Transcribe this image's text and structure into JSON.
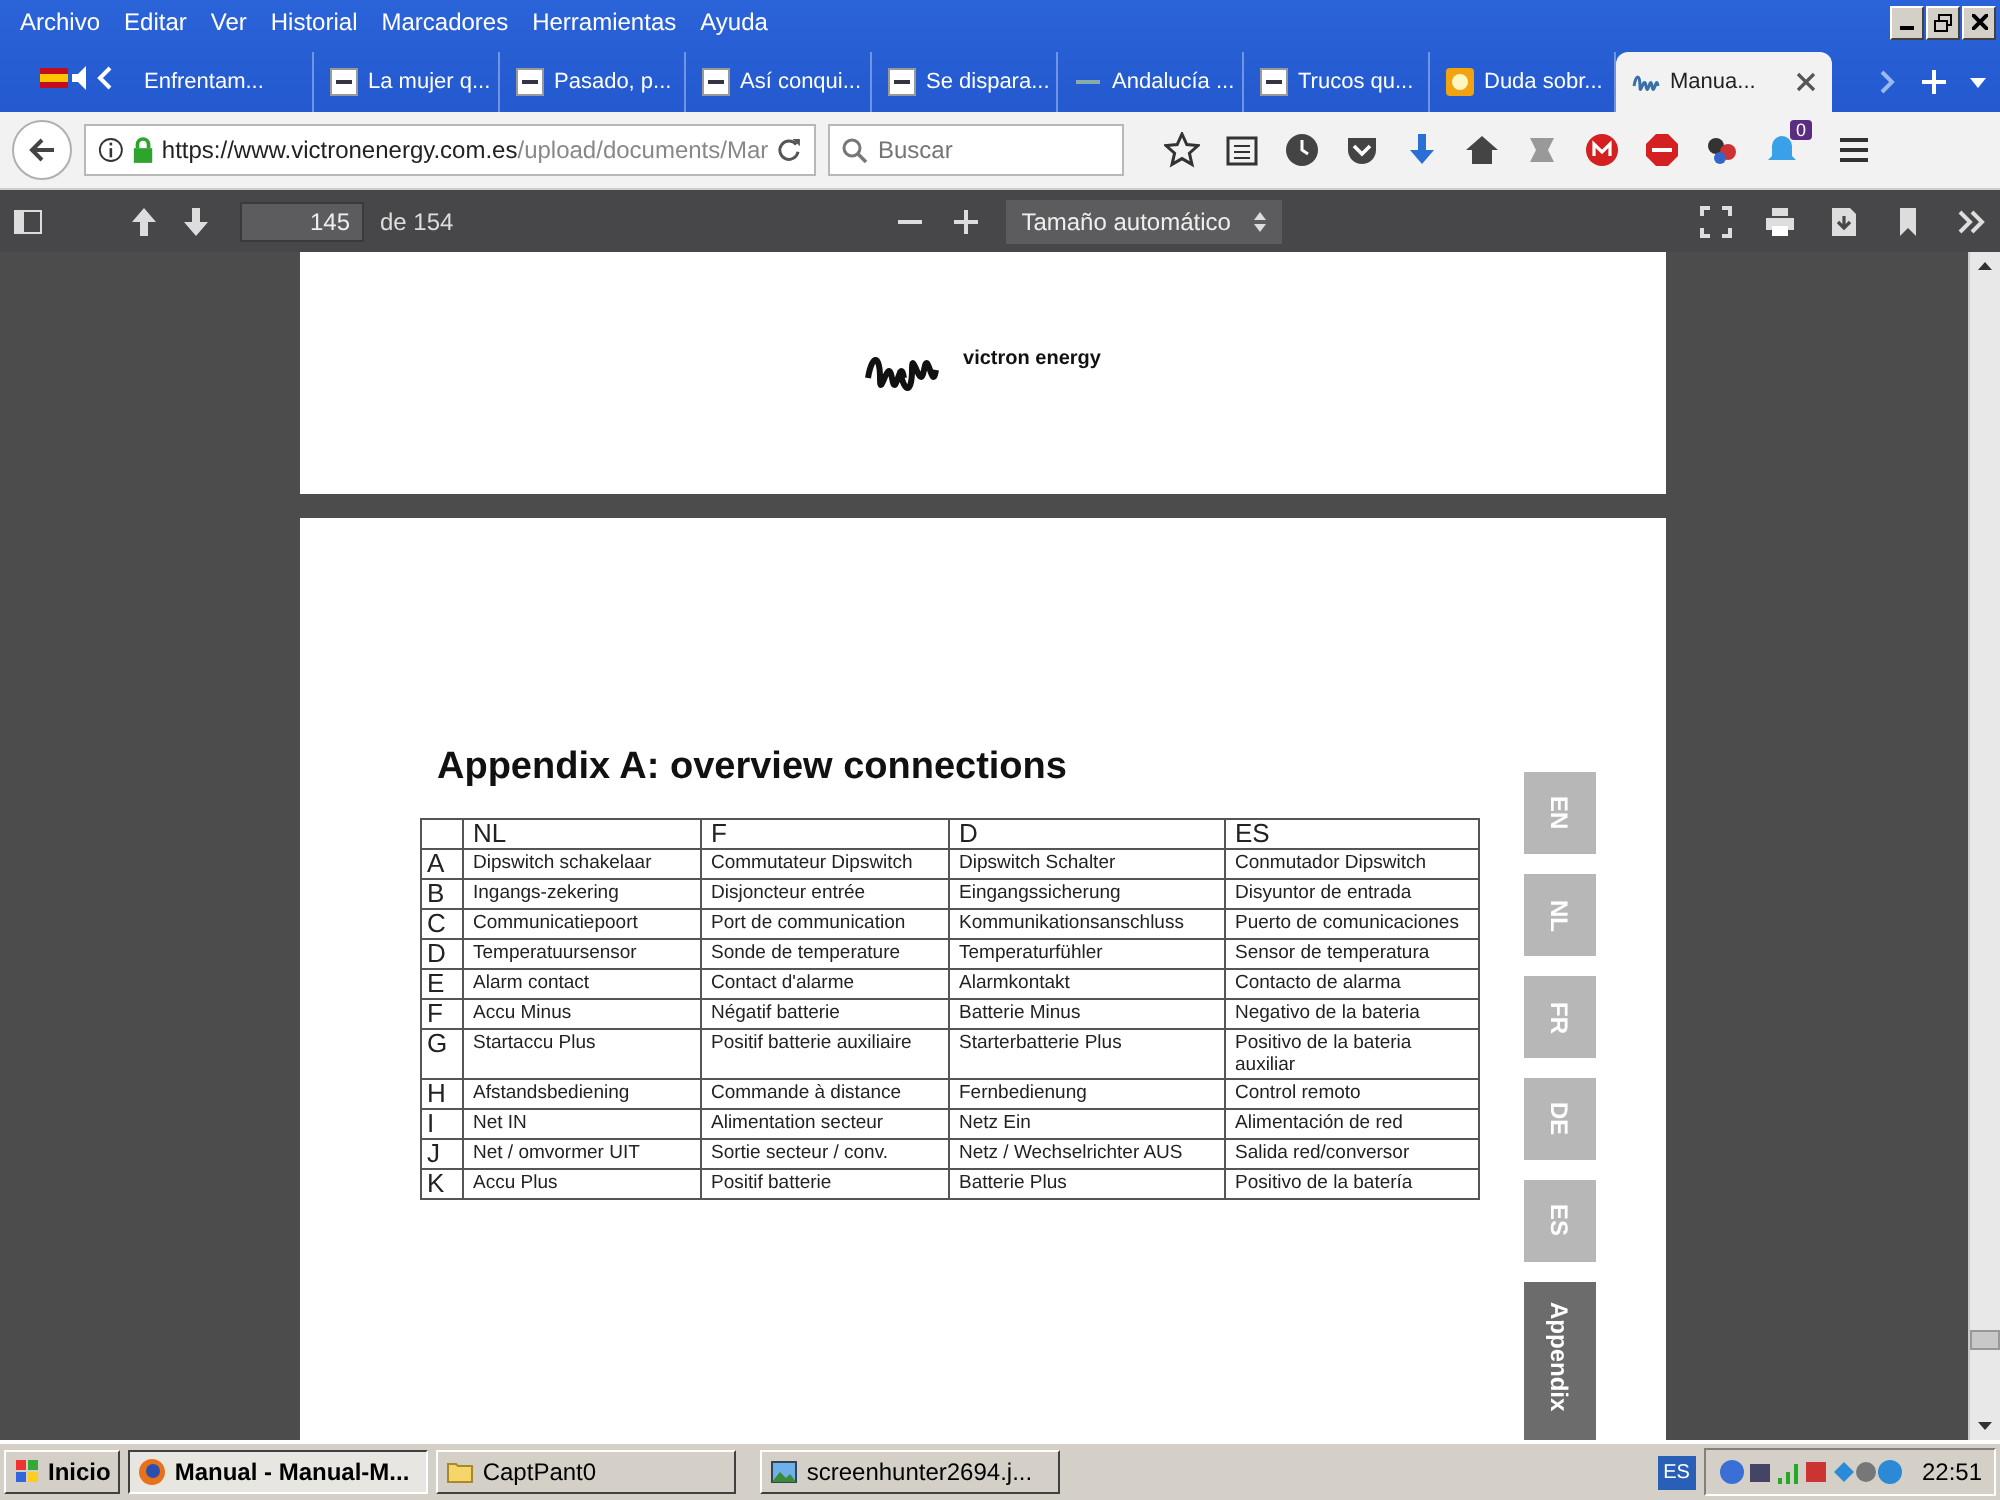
{
  "menu": [
    "Archivo",
    "Editar",
    "Ver",
    "Historial",
    "Marcadores",
    "Herramientas",
    "Ayuda"
  ],
  "tabs": [
    {
      "label": "Enfrentam...",
      "kind": "none",
      "selected": false
    },
    {
      "label": "La mujer q...",
      "kind": "abc",
      "selected": false
    },
    {
      "label": "Pasado, p...",
      "kind": "abc",
      "selected": false
    },
    {
      "label": "Así conqui...",
      "kind": "abc",
      "selected": false
    },
    {
      "label": "Se dispara...",
      "kind": "abc",
      "selected": false
    },
    {
      "label": "Andalucía ...",
      "kind": "abc-faded",
      "selected": false
    },
    {
      "label": "Trucos qu...",
      "kind": "abc",
      "selected": false
    },
    {
      "label": "Duda sobr...",
      "kind": "bulb",
      "selected": false
    },
    {
      "label": "Manua...",
      "kind": "coil",
      "selected": true
    }
  ],
  "address": {
    "host": "https://www.victronenergy.com.es",
    "path": "/upload/documents/Mar"
  },
  "search": {
    "placeholder": "Buscar"
  },
  "notification_badge": "0",
  "pdf_toolbar": {
    "page": "145",
    "page_count": "de 154",
    "zoom": "Tamaño automático"
  },
  "page_header": {
    "brand": "victron energy"
  },
  "document": {
    "title": "Appendix A: overview connections",
    "columns": [
      "NL",
      "F",
      "D",
      "ES"
    ],
    "rows": [
      {
        "key": "A",
        "cells": [
          "Dipswitch schakelaar",
          "Commutateur Dipswitch",
          "Dipswitch Schalter",
          "Conmutador Dipswitch"
        ]
      },
      {
        "key": "B",
        "cells": [
          "Ingangs-zekering",
          "Disjoncteur entrée",
          "Eingangssicherung",
          "Disyuntor de entrada"
        ]
      },
      {
        "key": "C",
        "cells": [
          "Communicatiepoort",
          "Port de communication",
          "Kommunikationsanschluss",
          "Puerto de comunicaciones"
        ]
      },
      {
        "key": "D",
        "cells": [
          "Temperatuursensor",
          "Sonde de temperature",
          "Temperaturfühler",
          "Sensor de temperatura"
        ]
      },
      {
        "key": "E",
        "cells": [
          "Alarm contact",
          "Contact d'alarme",
          "Alarmkontakt",
          "Contacto de alarma"
        ]
      },
      {
        "key": "F",
        "cells": [
          "Accu Minus",
          "Négatif batterie",
          "Batterie Minus",
          "Negativo de la bateria"
        ]
      },
      {
        "key": "G",
        "cells": [
          "Startaccu Plus",
          "Positif batterie auxiliaire",
          "Starterbatterie Plus",
          "Positivo de la bateria auxiliar"
        ]
      },
      {
        "key": "H",
        "cells": [
          "Afstandsbediening",
          "Commande à distance",
          "Fernbedienung",
          "Control remoto"
        ]
      },
      {
        "key": "I",
        "cells": [
          "Net IN",
          "Alimentation secteur",
          "Netz Ein",
          "Alimentación de red"
        ]
      },
      {
        "key": "J",
        "cells": [
          "Net / omvormer UIT",
          "Sortie secteur / conv.",
          "Netz / Wechselrichter AUS",
          "Salida red/conversor"
        ]
      },
      {
        "key": "K",
        "cells": [
          "Accu Plus",
          "Positif batterie",
          "Batterie Plus",
          "Positivo de la batería"
        ]
      }
    ],
    "side_tabs": [
      {
        "label": "EN",
        "selected": false
      },
      {
        "label": "NL",
        "selected": false
      },
      {
        "label": "FR",
        "selected": false
      },
      {
        "label": "DE",
        "selected": false
      },
      {
        "label": "ES",
        "selected": false
      },
      {
        "label": "Appendix",
        "selected": true
      }
    ]
  },
  "taskbar": {
    "start": "Inicio",
    "items": [
      {
        "label": "Manual - Manual-M...",
        "kind": "firefox",
        "selected": true
      },
      {
        "label": "CaptPant0",
        "kind": "folder",
        "selected": false
      },
      {
        "label": "screenhunter2694.j...",
        "kind": "image",
        "selected": false
      }
    ],
    "language": "ES",
    "clock": "22:51"
  }
}
